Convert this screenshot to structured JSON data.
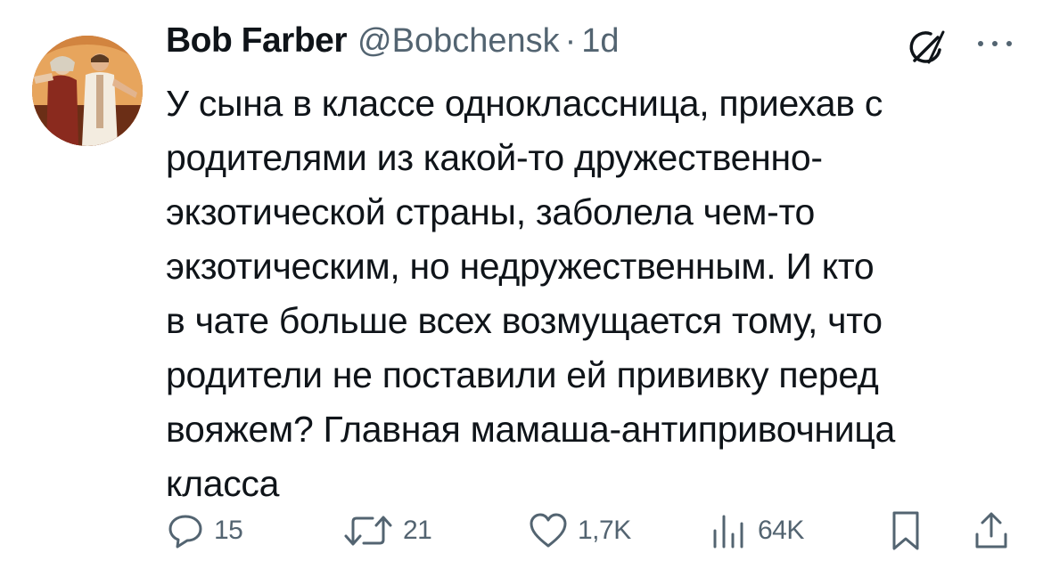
{
  "author": {
    "name": "Bob Farber",
    "handle": "@Bobchensk",
    "separator": "·",
    "time": "1d"
  },
  "tweet": {
    "lines": [
      "У сына в классе одноклассница, приехав с",
      "родителями из какой-то дружественно-",
      "экзотической страны, заболела чем-то",
      "экзотическим, но недружественным. И  кто",
      "в чате больше всех возмущается тому, что",
      "родители не поставили ей прививку перед",
      "вояжем? Главная мамаша-антипривочница",
      "класса"
    ]
  },
  "actions": {
    "replies": "15",
    "reposts": "21",
    "likes": "1,7K",
    "views": "64K"
  },
  "icons": {
    "avatar": "avatar-photo",
    "grok": "grok-icon",
    "more": "more-icon",
    "reply": "reply-icon",
    "repost": "repost-icon",
    "like": "heart-icon",
    "views": "views-icon",
    "bookmark": "bookmark-icon",
    "share": "share-icon"
  },
  "colors": {
    "text": "#0f1419",
    "secondary": "#536471"
  }
}
